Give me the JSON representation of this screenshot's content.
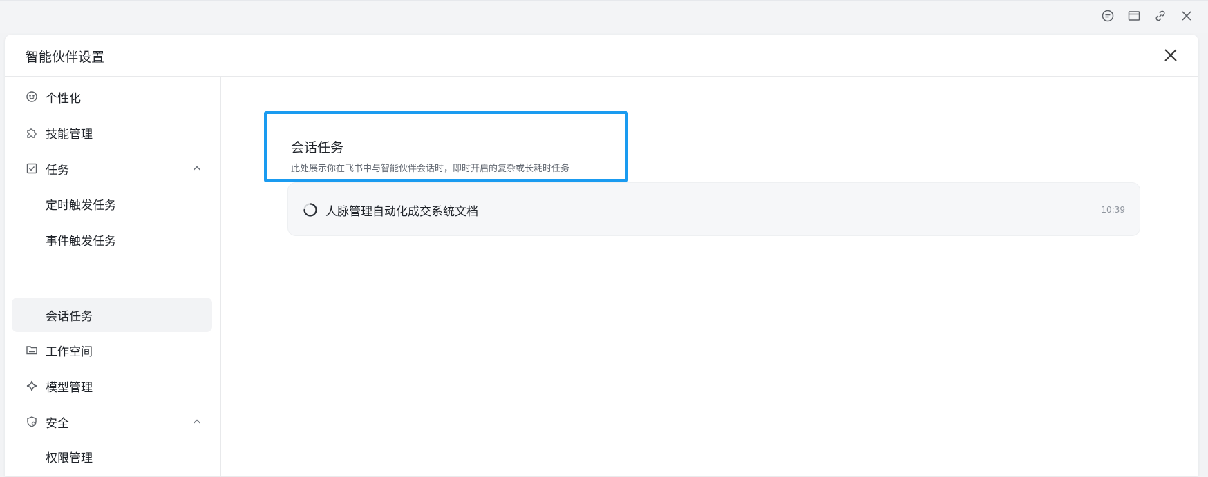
{
  "window": {
    "top_icons": [
      "chat-bubble-icon",
      "window-icon",
      "link-icon",
      "close-icon"
    ]
  },
  "dialog": {
    "title": "智能伙伴设置"
  },
  "sidebar": {
    "items": [
      {
        "label": "个性化",
        "icon": "smiley-icon"
      },
      {
        "label": "技能管理",
        "icon": "puzzle-icon"
      },
      {
        "label": "任务",
        "icon": "task-check-icon",
        "expanded": true
      },
      {
        "label": "定时触发任务",
        "sub": true
      },
      {
        "label": "事件触发任务",
        "sub": true
      },
      {
        "label": "会话任务",
        "sub": true,
        "active": true
      },
      {
        "label": "工作空间",
        "icon": "folder-icon"
      },
      {
        "label": "模型管理",
        "icon": "sparkle-icon"
      },
      {
        "label": "安全",
        "icon": "shield-gear-icon",
        "expanded": true
      },
      {
        "label": "权限管理",
        "sub": true
      }
    ]
  },
  "main": {
    "section_title": "会话任务",
    "section_desc": "此处展示你在飞书中与智能伙伴会话时，即时开启的复杂或长耗时任务",
    "tasks": [
      {
        "name": "人脉管理自动化成交系统文档",
        "time": "10:39",
        "status": "running"
      }
    ]
  },
  "colors": {
    "highlight_border": "#1a9bf0",
    "active_bg": "#f2f3f5"
  }
}
